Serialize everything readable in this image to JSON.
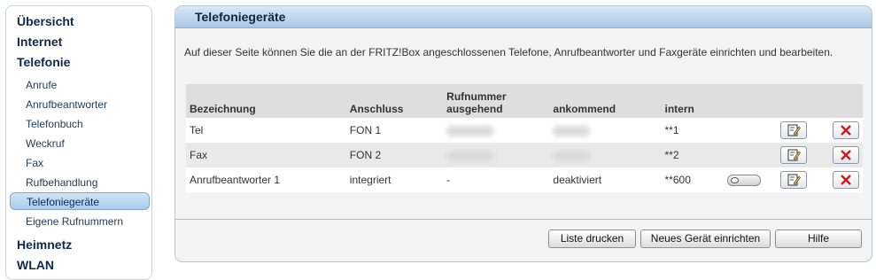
{
  "sidebar": {
    "items": [
      {
        "label": "Übersicht",
        "level": "main"
      },
      {
        "label": "Internet",
        "level": "main"
      },
      {
        "label": "Telefonie",
        "level": "main"
      },
      {
        "label": "Anrufe",
        "level": "sub"
      },
      {
        "label": "Anrufbeantworter",
        "level": "sub"
      },
      {
        "label": "Telefonbuch",
        "level": "sub"
      },
      {
        "label": "Weckruf",
        "level": "sub"
      },
      {
        "label": "Fax",
        "level": "sub"
      },
      {
        "label": "Rufbehandlung",
        "level": "sub"
      },
      {
        "label": "Telefoniegeräte",
        "level": "sub",
        "active": true
      },
      {
        "label": "Eigene Rufnummern",
        "level": "sub"
      },
      {
        "label": "Heimnetz",
        "level": "main"
      },
      {
        "label": "WLAN",
        "level": "main"
      }
    ]
  },
  "panel": {
    "title": "Telefoniegeräte",
    "intro": "Auf dieser Seite können Sie die an der FRITZ!Box angeschlossenen Telefone, Anrufbeantworter und Faxgeräte einrichten und bearbeiten."
  },
  "table": {
    "headers": {
      "name": "Bezeichnung",
      "port": "Anschluss",
      "outgoing_line1": "Rufnummer",
      "outgoing_line2": "ausgehend",
      "incoming": "ankommend",
      "internal": "intern"
    },
    "rows": [
      {
        "name": "Tel",
        "port": "FON 1",
        "outgoing": "",
        "incoming": "",
        "internal": "**1"
      },
      {
        "name": "Fax",
        "port": "FON 2",
        "outgoing": "",
        "incoming": "",
        "internal": "**2"
      },
      {
        "name": "Anrufbeantworter 1",
        "port": "integriert",
        "outgoing": "-",
        "incoming": "deaktiviert",
        "internal": "**600",
        "toggle": "off"
      }
    ]
  },
  "buttons": {
    "print": "Liste drucken",
    "new_device": "Neues Gerät einrichten",
    "help": "Hilfe"
  },
  "icons": {
    "edit": "edit-icon",
    "delete": "delete-icon"
  },
  "colors": {
    "sidebar_text": "#0d2a4d",
    "header_gradient_top": "#d8e8f6",
    "header_gradient_bottom": "#a9c8e6",
    "delete_red": "#d11a1a"
  }
}
